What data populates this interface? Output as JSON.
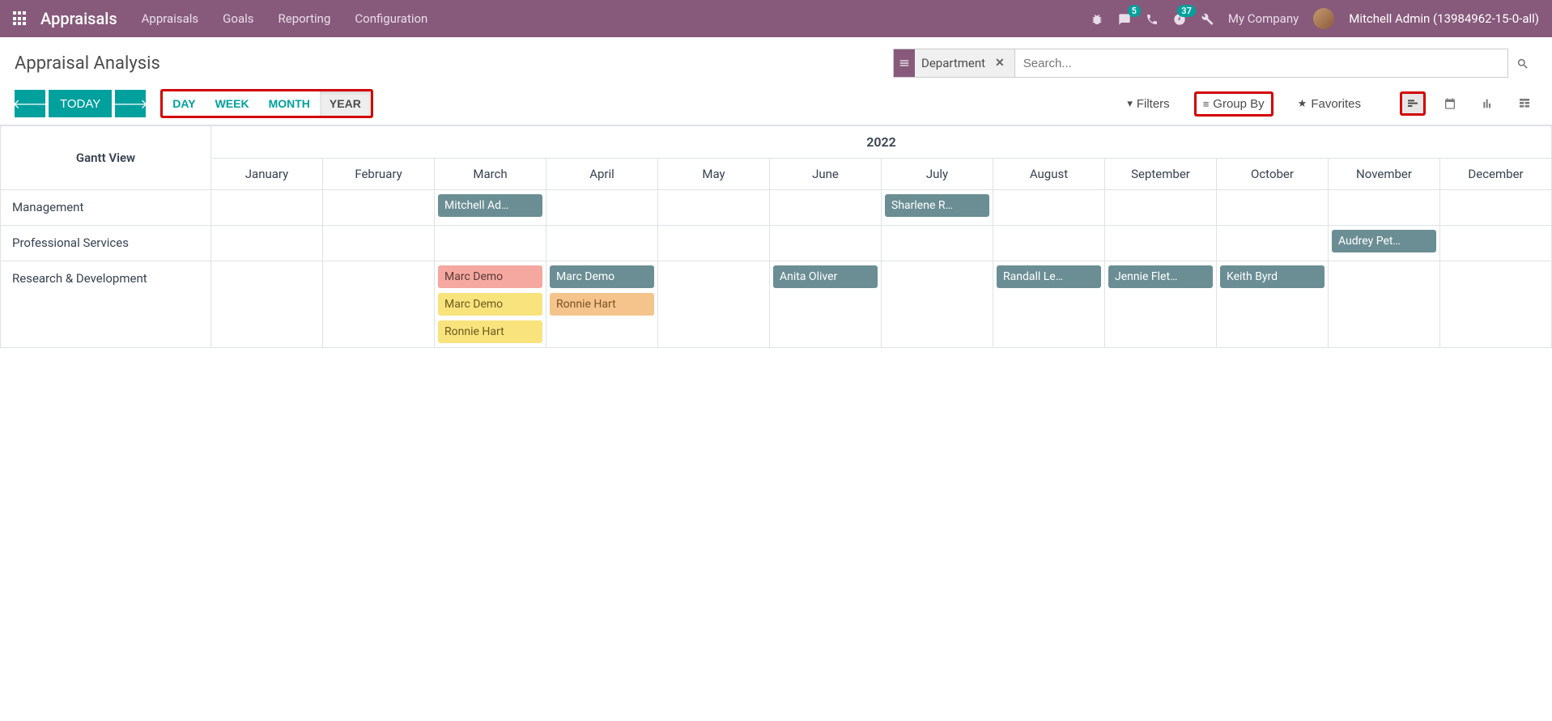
{
  "nav": {
    "brand": "Appraisals",
    "menu": [
      "Appraisals",
      "Goals",
      "Reporting",
      "Configuration"
    ],
    "messages_badge": "5",
    "activities_badge": "37",
    "company": "My Company",
    "user": "Mitchell Admin (13984962-15-0-all)"
  },
  "cp": {
    "title": "Appraisal Analysis",
    "search_facet": "Department",
    "search_placeholder": "Search...",
    "today": "TODAY",
    "scales": [
      "DAY",
      "WEEK",
      "MONTH",
      "YEAR"
    ],
    "active_scale": "YEAR",
    "filters": "Filters",
    "groupby": "Group By",
    "favorites": "Favorites"
  },
  "gantt": {
    "corner": "Gantt View",
    "year": "2022",
    "months": [
      "January",
      "February",
      "March",
      "April",
      "May",
      "June",
      "July",
      "August",
      "September",
      "October",
      "November",
      "December"
    ],
    "rows": [
      {
        "label": "Management",
        "cells": {
          "March": [
            {
              "text": "Mitchell Ad…",
              "color": "teal"
            }
          ],
          "July": [
            {
              "text": "Sharlene R…",
              "color": "teal"
            }
          ]
        }
      },
      {
        "label": "Professional Services",
        "cells": {
          "November": [
            {
              "text": "Audrey Pet…",
              "color": "teal"
            }
          ]
        }
      },
      {
        "label": "Research & Development",
        "cells": {
          "March": [
            {
              "text": "Marc Demo",
              "color": "salmon"
            },
            {
              "text": "Marc Demo",
              "color": "yellow"
            },
            {
              "text": "Ronnie Hart",
              "color": "yellow"
            }
          ],
          "April": [
            {
              "text": "Marc Demo",
              "color": "teal"
            },
            {
              "text": "Ronnie Hart",
              "color": "orange"
            }
          ],
          "June": [
            {
              "text": "Anita Oliver",
              "color": "teal"
            }
          ],
          "August": [
            {
              "text": "Randall Le…",
              "color": "teal"
            }
          ],
          "September": [
            {
              "text": "Jennie Flet…",
              "color": "teal"
            }
          ],
          "October": [
            {
              "text": "Keith Byrd",
              "color": "teal"
            }
          ]
        }
      }
    ]
  }
}
